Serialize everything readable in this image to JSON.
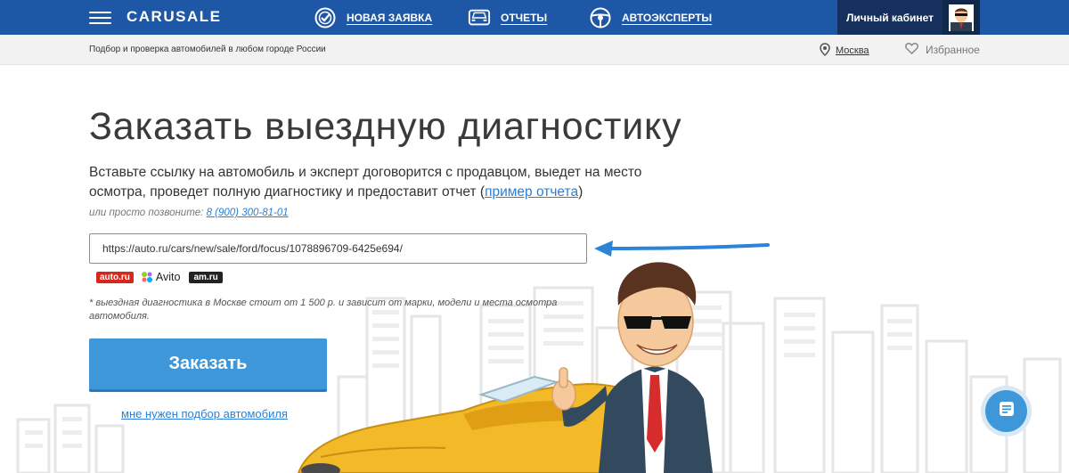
{
  "header": {
    "brand": "CARUSALE",
    "nav": [
      {
        "label": "НОВАЯ ЗАЯВКА",
        "icon": "check-circle-icon"
      },
      {
        "label": "ОТЧЕТЫ",
        "icon": "car-front-icon"
      },
      {
        "label": "АВТОЭКСПЕРТЫ",
        "icon": "steering-wheel-icon"
      }
    ],
    "cabinet_label": "Личный кабинет",
    "avatar_icon": "user-avatar-icon"
  },
  "subbar": {
    "tagline": "Подбор и проверка автомобилей в любом городе России",
    "city": "Москва",
    "favorites_label": "Избранное"
  },
  "main": {
    "title": "Заказать выездную диагностику",
    "description": "Вставьте ссылку на автомобиль и эксперт договорится с продавцом, выедет на место осмотра, проведет полную диагностику и предоставит отчет (",
    "report_link": "пример отчета",
    "description_end": ")",
    "call_text": "или просто позвоните: ",
    "phone": "8 (900) 300-81-01",
    "url_value": "https://auto.ru/cars/new/sale/ford/focus/1078896709-6425e694/",
    "logos": [
      "auto.ru",
      "Avito",
      "am.ru"
    ],
    "note": "* выездная диагностика в Москве стоит от 1 500 р. и зависит от марки, модели и места осмотра автомобиля.",
    "order_button": "Заказать",
    "pick_link": "мне нужен подбор автомобиля"
  },
  "colors": {
    "topbar": "#1e57a6",
    "cabinet": "#16305d",
    "button": "#3e97d9",
    "link": "#2b7fd6",
    "car": "#f2b928"
  }
}
